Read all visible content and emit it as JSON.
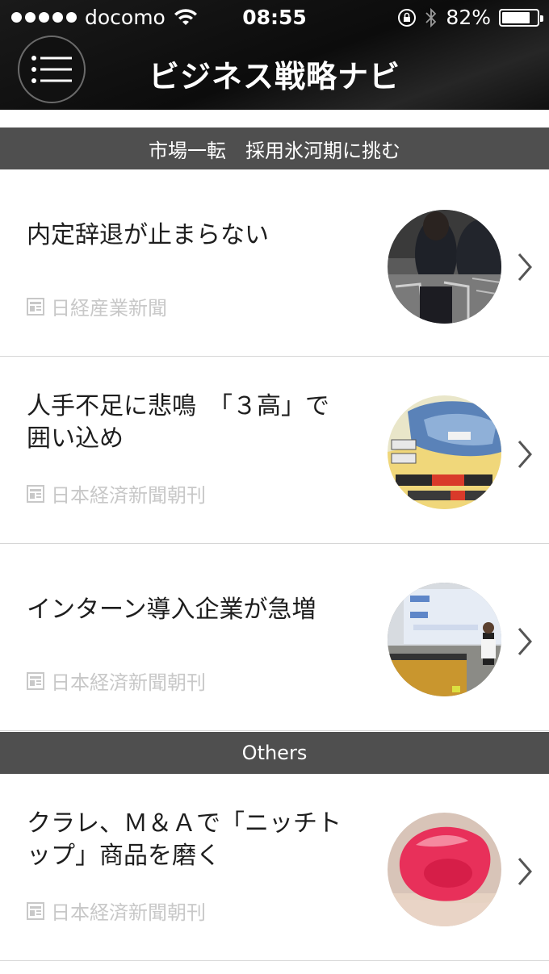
{
  "status_bar": {
    "carrier": "docomo",
    "time": "08:55",
    "battery_text": "82%",
    "battery_level": 0.82
  },
  "header": {
    "title": "ビジネス戦略ナビ"
  },
  "sections": [
    {
      "title": "市場一転　採用氷河期に挑む",
      "articles": [
        {
          "title": "内定辞退が止まらない",
          "source": "日経産業新聞"
        },
        {
          "title": "人手不足に悲鳴　「３高」で囲い込め",
          "source": "日本経済新聞朝刊"
        },
        {
          "title": "インターン導入企業が急増",
          "source": "日本経済新聞朝刊"
        }
      ]
    },
    {
      "title": "Others",
      "articles": [
        {
          "title": "クラレ、Ｍ＆Ａで「ニッチトップ」商品を磨く",
          "source": "日本経済新聞朝刊"
        }
      ]
    }
  ],
  "colors": {
    "header_bg": "#111111",
    "section_bg": "#4f4f4f",
    "source_text": "#c8c8c8"
  }
}
